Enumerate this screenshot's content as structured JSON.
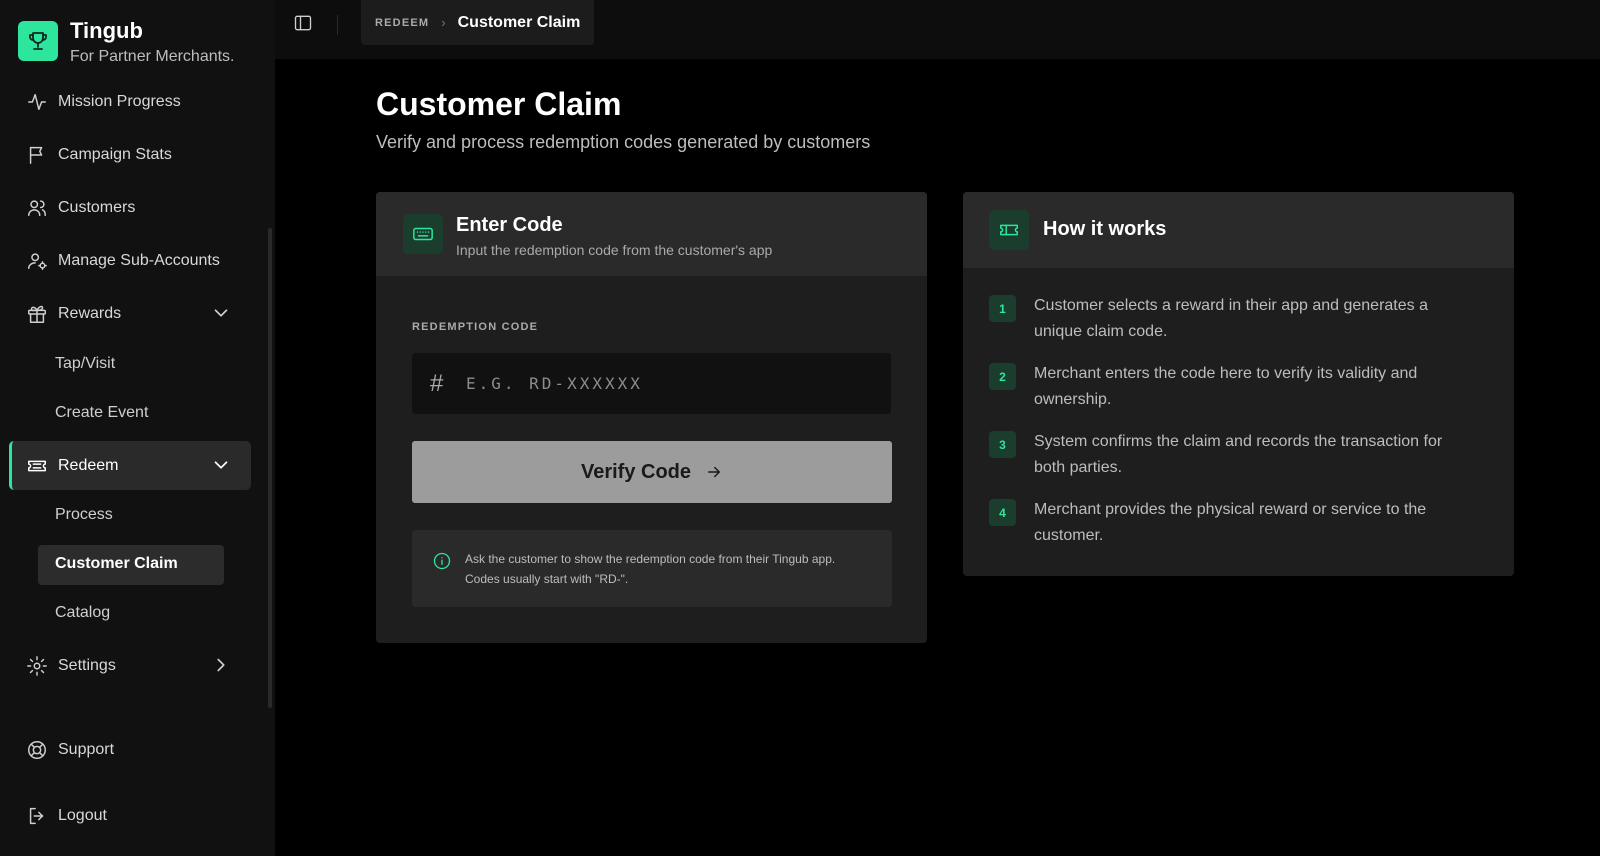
{
  "brand": {
    "name": "Tingub",
    "tagline": "For Partner Merchants."
  },
  "sidebar": {
    "items": [
      {
        "label": "Mission Progress",
        "icon": "activity-icon"
      },
      {
        "label": "Campaign Stats",
        "icon": "flag-icon"
      },
      {
        "label": "Customers",
        "icon": "users-icon"
      },
      {
        "label": "Manage Sub-Accounts",
        "icon": "user-cog-icon"
      },
      {
        "label": "Rewards",
        "icon": "gift-icon",
        "expanded": true,
        "children": [
          "Tap/Visit",
          "Create Event"
        ]
      },
      {
        "label": "Redeem",
        "icon": "ticket-icon",
        "expanded": true,
        "active": true,
        "children": [
          "Process",
          "Customer Claim",
          "Catalog"
        ]
      },
      {
        "label": "Settings",
        "icon": "gear-icon",
        "expanded": false
      }
    ],
    "footer": [
      {
        "label": "Support",
        "icon": "life-buoy-icon"
      },
      {
        "label": "Logout",
        "icon": "logout-icon"
      }
    ]
  },
  "topbar": {
    "breadcrumb_parent": "REDEEM",
    "breadcrumb_current": "Customer Claim"
  },
  "main": {
    "title": "Customer Claim",
    "subtitle": "Verify and process redemption codes generated by customers"
  },
  "enter_card": {
    "title": "Enter Code",
    "subtitle": "Input the redemption code from the customer's app",
    "field_label": "REDEMPTION CODE",
    "prefix": "#",
    "placeholder": "E.G. RD-XXXXXX",
    "value": "",
    "button_label": "Verify Code",
    "info": "Ask the customer to show the redemption code from their Tingub app. Codes usually start with \"RD-\"."
  },
  "how_card": {
    "title": "How it works",
    "steps": [
      {
        "num": "1",
        "text": "Customer selects a reward in their app and generates a unique claim code."
      },
      {
        "num": "2",
        "text": "Merchant enters the code here to verify its validity and ownership."
      },
      {
        "num": "3",
        "text": "System confirms the claim and records the transaction for both parties."
      },
      {
        "num": "4",
        "text": "Merchant provides the physical reward or service to the customer."
      }
    ]
  },
  "colors": {
    "accent": "#2ee59d",
    "background": "#000000",
    "sidebar": "#111111",
    "card": "#1e1e1e",
    "button_disabled": "#9c9c9c"
  }
}
